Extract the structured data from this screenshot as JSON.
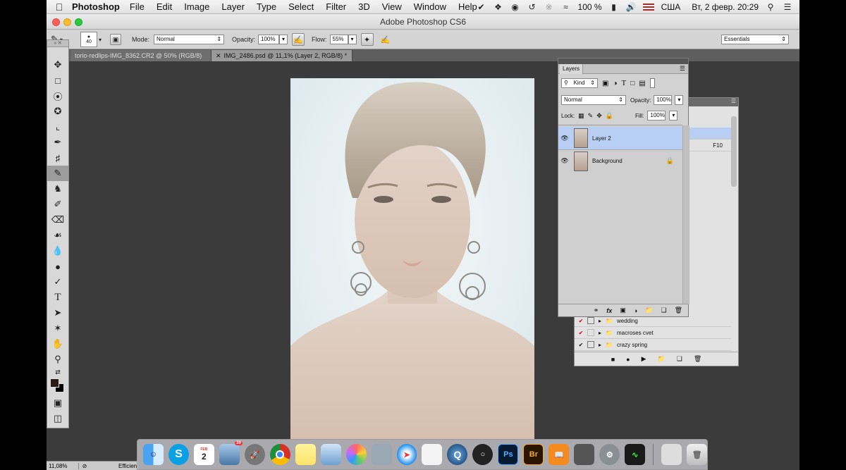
{
  "menubar": {
    "apple": "",
    "app": "Photoshop",
    "items": [
      "File",
      "Edit",
      "Image",
      "Layer",
      "Type",
      "Select",
      "Filter",
      "3D",
      "View",
      "Window",
      "Help"
    ],
    "battery": "100 %",
    "input_source": "США",
    "datetime": "Вт, 2 февр.  20:29"
  },
  "window": {
    "title": "Adobe Photoshop CS6"
  },
  "options": {
    "brush_size": "40",
    "mode_label": "Mode:",
    "mode_value": "Normal",
    "opacity_label": "Opacity:",
    "opacity_value": "100%",
    "flow_label": "Flow:",
    "flow_value": "55%",
    "workspace": "Essentials"
  },
  "tabs": [
    {
      "label": "torio-redlips-IMG_8362.CR2 @ 50% (RGB/8)"
    },
    {
      "label": "IMG_2486.psd @ 11,1% (Layer 2, RGB/8) *"
    }
  ],
  "layers_panel": {
    "title": "Layers",
    "filter_kind": "Kind",
    "blend_mode": "Normal",
    "opacity_label": "Opacity:",
    "opacity_value": "100%",
    "lock_label": "Lock:",
    "fill_label": "Fill:",
    "fill_value": "100%",
    "layers": [
      {
        "name": "Layer 2",
        "selected": true
      },
      {
        "name": "Background",
        "locked": true
      }
    ],
    "footer_fx": "fx"
  },
  "actions_panel": {
    "shortcut": "F10",
    "items": [
      {
        "name": "wedding"
      },
      {
        "name": "macroses cvet"
      },
      {
        "name": "crazy spring"
      }
    ]
  },
  "status": {
    "zoom": "11,08%",
    "info": "Efficien"
  },
  "dock": {
    "calendar_month": "FEB",
    "calendar_day": "2",
    "badge": "39",
    "apps": [
      "finder",
      "skype",
      "calendar",
      "preview",
      "launchpad",
      "chrome",
      "notes",
      "photo-browser",
      "photos",
      "image-capture",
      "safari",
      "textedit",
      "quicktime",
      "obs",
      "photoshop",
      "bridge",
      "ibooks",
      "calculator",
      "system-preferences",
      "activity-monitor",
      "downloads",
      "trash"
    ],
    "labels": {
      "photoshop": "Ps",
      "bridge": "Br"
    }
  }
}
